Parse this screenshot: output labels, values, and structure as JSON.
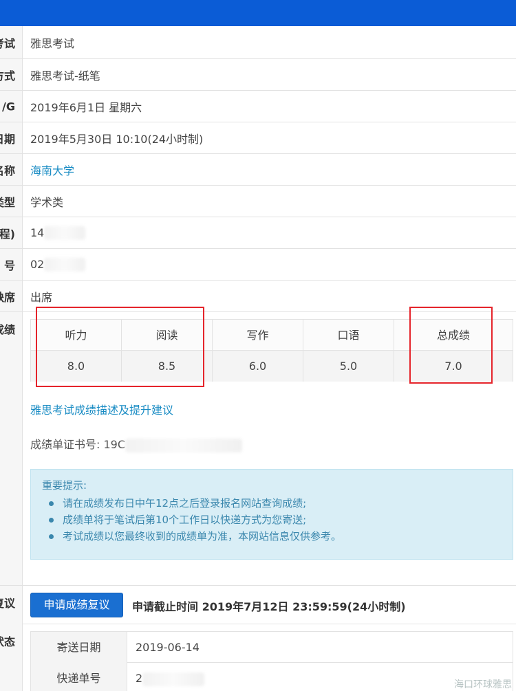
{
  "info_rows": [
    {
      "label": "考试",
      "value": "雅思考试"
    },
    {
      "label": "方式",
      "value": "雅思考试-纸笔"
    },
    {
      "label": "/G",
      "value": "2019年6月1日 星期六"
    },
    {
      "label": "日期",
      "value": "2019年5月30日 10:10(24小时制)"
    },
    {
      "label": "名称",
      "value": "海南大学"
    },
    {
      "label": "类型",
      "value": "学术类"
    },
    {
      "label": "程)",
      "value": "14"
    },
    {
      "label": "号",
      "value": "02"
    },
    {
      "label": "缺席",
      "value": "出席"
    }
  ],
  "scores_label": "成绩",
  "scores": {
    "headers": [
      "听力",
      "阅读",
      "写作",
      "口语",
      "总成绩"
    ],
    "values": [
      "8.0",
      "8.5",
      "6.0",
      "5.0",
      "7.0"
    ]
  },
  "score_description_link": "雅思考试成绩描述及提升建议",
  "certificate_number": "成绩单证书号: 19C",
  "notice": {
    "title": "重要提示:",
    "items": [
      "请在成绩发布日中午12点之后登录报名网站查询成绩;",
      "成绩单将于笔试后第10个工作日以快递方式为您寄送;",
      "考试成绩以您最终收到的成绩单为准，本网站信息仅供参考。"
    ]
  },
  "review": {
    "label": "复议",
    "button": "申请成绩复议",
    "deadline": "申请截止时间 2019年7月12日 23:59:59(24小时制)"
  },
  "shipping": {
    "label": "状态",
    "rows": [
      {
        "key": "寄送日期",
        "value": "2019-06-14"
      },
      {
        "key": "快递单号",
        "value": "2"
      }
    ]
  },
  "watermark": "海口环球雅思",
  "colors": {
    "topbar": "#0b5cd6",
    "link": "#1a8cc4",
    "highlight": "#e5242b",
    "button": "#1a6fd1"
  }
}
